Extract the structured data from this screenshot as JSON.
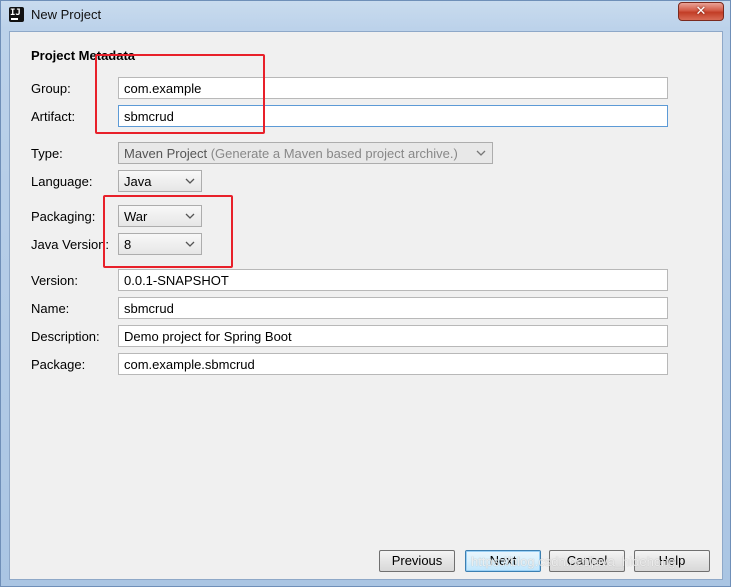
{
  "window": {
    "title": "New Project",
    "close_glyph": "✕"
  },
  "section": {
    "title": "Project Metadata"
  },
  "fields": {
    "group": {
      "label": "Group:",
      "value": "com.example"
    },
    "artifact": {
      "label": "Artifact:",
      "value": "sbmcrud"
    },
    "type": {
      "label": "Type:",
      "value": "Maven Project",
      "hint": "(Generate a Maven based project archive.)"
    },
    "language": {
      "label": "Language:",
      "value": "Java"
    },
    "packaging": {
      "label": "Packaging:",
      "value": "War"
    },
    "java_version": {
      "label": "Java Version:",
      "value": "8"
    },
    "version": {
      "label": "Version:",
      "value": "0.0.1-SNAPSHOT"
    },
    "name": {
      "label": "Name:",
      "value": "sbmcrud"
    },
    "description": {
      "label": "Description:",
      "value": "Demo project for Spring Boot"
    },
    "package": {
      "label": "Package:",
      "value": "com.example.sbmcrud"
    }
  },
  "buttons": {
    "previous": "Previous",
    "next": "Next",
    "cancel": "Cancel",
    "help": "Help"
  },
  "icons": {
    "app": "intellij-idea-icon",
    "app_glyph": "IJ",
    "close": "close-icon",
    "dropdown": "chevron-down-icon"
  },
  "colors": {
    "annotation": "#e8202a",
    "focus_border": "#5c9ad6",
    "close_button": "#c23d26"
  },
  "watermark": "https://blog.csdn.net/java_hidehong"
}
